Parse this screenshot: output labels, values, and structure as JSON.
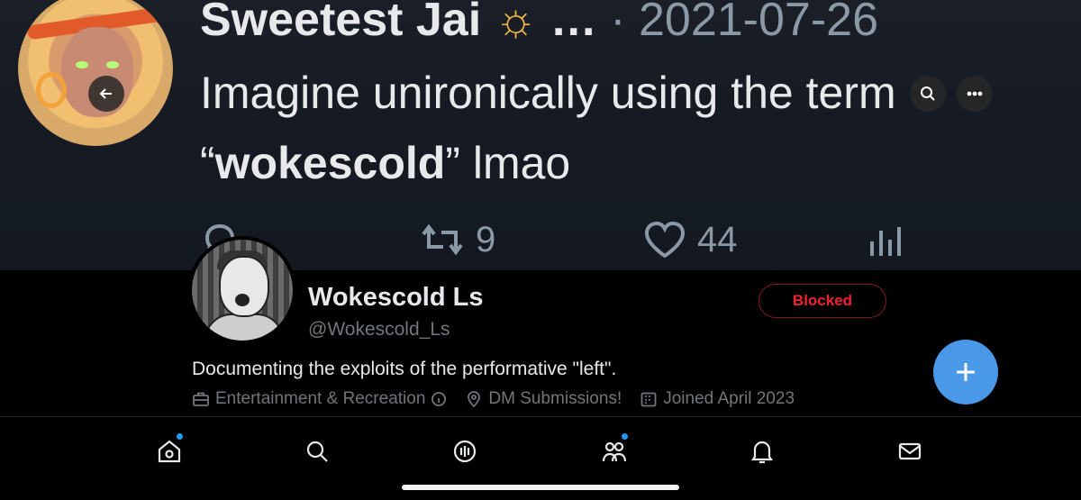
{
  "banner": {
    "tweet_author": "Sweetest Jai",
    "author_emoji": "☼",
    "ellipsis": "…",
    "separator": "·",
    "tweet_date": "2021-07-26",
    "tweet_text_line1": "Imagine unironically using the term",
    "tweet_text_quote_open": "“",
    "tweet_text_bold": "wokescold",
    "tweet_text_quote_close": "”",
    "tweet_text_tail": " lmao",
    "retweet_count": "9",
    "like_count": "44",
    "icons": [
      "reply-icon",
      "retweet-icon",
      "like-icon",
      "analytics-icon"
    ]
  },
  "top_controls": {
    "back_icon": "back-arrow-icon",
    "search_icon": "search-icon",
    "more_icon": "more-icon"
  },
  "profile": {
    "display_name": "Wokescold Ls",
    "handle": "@Wokescold_Ls",
    "blocked_label": "Blocked",
    "bio": "Documenting the exploits of the performative \"left\".",
    "category": "Entertainment & Recreation",
    "location": "DM Submissions!",
    "joined": "Joined April 2023"
  },
  "fab": {
    "icon": "plus-icon"
  },
  "bottom_nav": {
    "items": [
      "home-icon",
      "search-icon",
      "spaces-icon",
      "communities-icon",
      "notifications-icon",
      "messages-icon"
    ]
  },
  "colors": {
    "accent": "#1d9bf0",
    "blocked_red": "#f4212e",
    "fab_blue": "#4a99e9",
    "muted": "#71767b"
  }
}
